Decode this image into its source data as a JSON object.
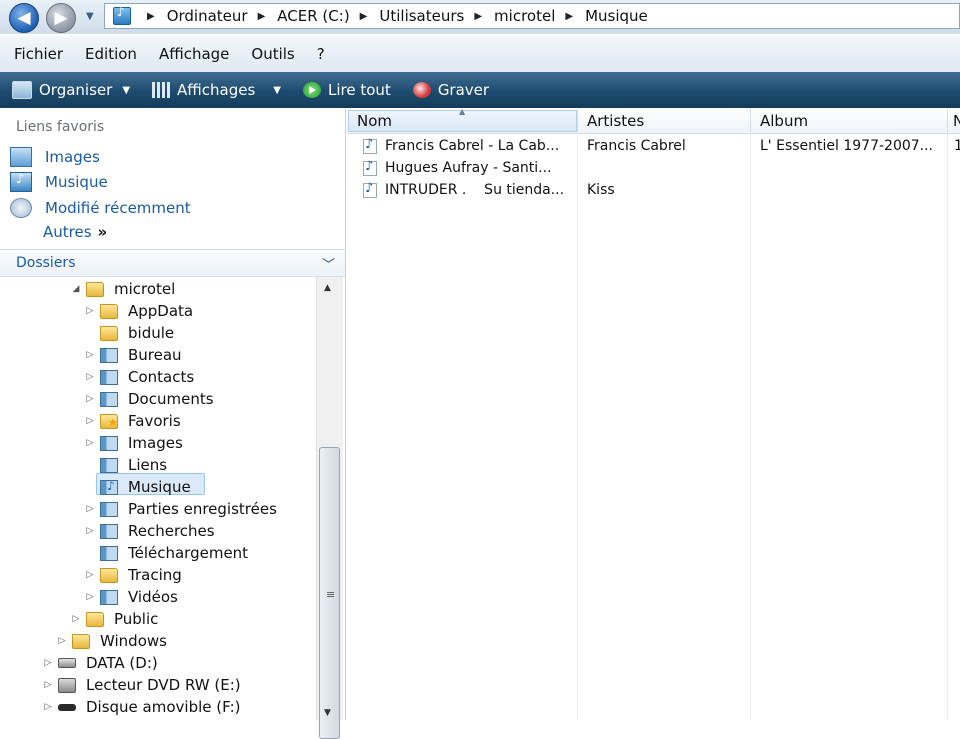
{
  "breadcrumb": [
    "Ordinateur",
    "ACER (C:)",
    "Utilisateurs",
    "microtel",
    "Musique"
  ],
  "menu": [
    "Fichier",
    "Edition",
    "Affichage",
    "Outils",
    "?"
  ],
  "toolbar": {
    "organize": "Organiser",
    "views": "Affichages",
    "play_all": "Lire tout",
    "burn": "Graver"
  },
  "favorites": {
    "title": "Liens favoris",
    "items": [
      "Images",
      "Musique",
      "Modifié récemment"
    ],
    "more": "Autres",
    "more_glyph": "»"
  },
  "folders": {
    "title": "Dossiers",
    "tree": [
      {
        "label": "microtel",
        "expander": "◢",
        "icon": "folder"
      },
      {
        "label": "AppData",
        "expander": "▷",
        "icon": "folder"
      },
      {
        "label": "bidule",
        "expander": "",
        "icon": "folder"
      },
      {
        "label": "Bureau",
        "expander": "▷",
        "icon": "system-folder"
      },
      {
        "label": "Contacts",
        "expander": "▷",
        "icon": "system-folder"
      },
      {
        "label": "Documents",
        "expander": "▷",
        "icon": "system-folder"
      },
      {
        "label": "Favoris",
        "expander": "▷",
        "icon": "favorites-folder"
      },
      {
        "label": "Images",
        "expander": "▷",
        "icon": "system-folder"
      },
      {
        "label": "Liens",
        "expander": "",
        "icon": "system-folder"
      },
      {
        "label": "Musique",
        "expander": "",
        "icon": "music-folder",
        "selected": true
      },
      {
        "label": "Parties enregistrées",
        "expander": "▷",
        "icon": "system-folder"
      },
      {
        "label": "Recherches",
        "expander": "▷",
        "icon": "system-folder"
      },
      {
        "label": "Téléchargement",
        "expander": "",
        "icon": "system-folder"
      },
      {
        "label": "Tracing",
        "expander": "▷",
        "icon": "folder"
      },
      {
        "label": "Vidéos",
        "expander": "▷",
        "icon": "system-folder"
      },
      {
        "label": "Public",
        "expander": "▷",
        "icon": "folder"
      },
      {
        "label": "Windows",
        "expander": "▷",
        "icon": "folder"
      },
      {
        "label": "DATA (D:)",
        "expander": "▷",
        "icon": "drive"
      },
      {
        "label": "Lecteur DVD RW (E:)",
        "expander": "▷",
        "icon": "dvd"
      },
      {
        "label": "Disque amovible (F:)",
        "expander": "▷",
        "icon": "usb"
      }
    ]
  },
  "columns": [
    "Nom",
    "Artistes",
    "Album",
    "N"
  ],
  "files": [
    {
      "name": "Francis Cabrel - La Cab...",
      "artist": "Francis Cabrel",
      "album": "L' Essentiel 1977-2007...",
      "extra": "1"
    },
    {
      "name": "Hugues Aufray - Santi...",
      "artist": "",
      "album": "",
      "extra": ""
    },
    {
      "name": "INTRUDER .    Su tienda...",
      "artist": "Kiss",
      "album": "",
      "extra": ""
    }
  ],
  "colors": {
    "link_blue": "#1a5aa6",
    "command_bar": "#1d4b6f",
    "selection": "#dbeaf8"
  }
}
